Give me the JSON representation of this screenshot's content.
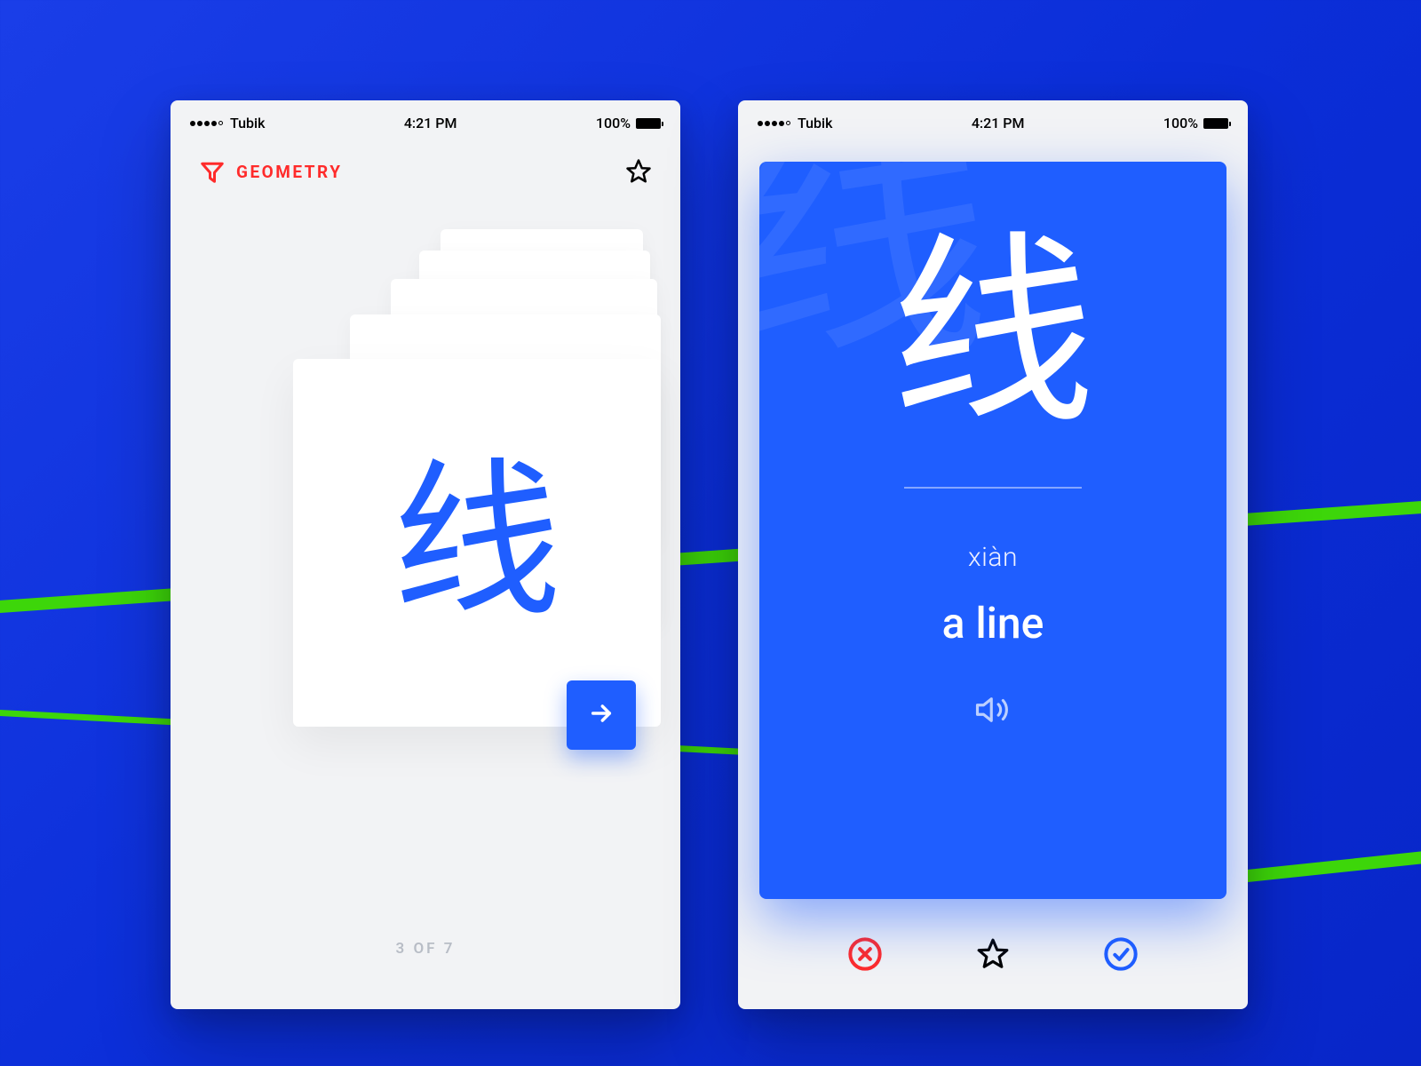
{
  "statusbar": {
    "carrier": "Tubik",
    "time": "4:21 PM",
    "battery": "100%"
  },
  "left": {
    "category": "GEOMETRY",
    "card_hanzi": "线",
    "counter": "3 OF 7"
  },
  "right": {
    "bg_hanzi": "线",
    "hanzi": "线",
    "pinyin": "xiàn",
    "meaning": "a line"
  },
  "icons": {
    "funnel": "funnel-icon",
    "star": "star-icon",
    "arrow_right": "arrow-right-icon",
    "speaker": "speaker-icon",
    "reject": "x-circle-icon",
    "approve": "check-circle-icon"
  },
  "colors": {
    "accent_blue": "#1f5eff",
    "accent_red": "#ff2b2b",
    "accent_green": "#3dd60a",
    "bg_blue": "#0b2ed8"
  }
}
